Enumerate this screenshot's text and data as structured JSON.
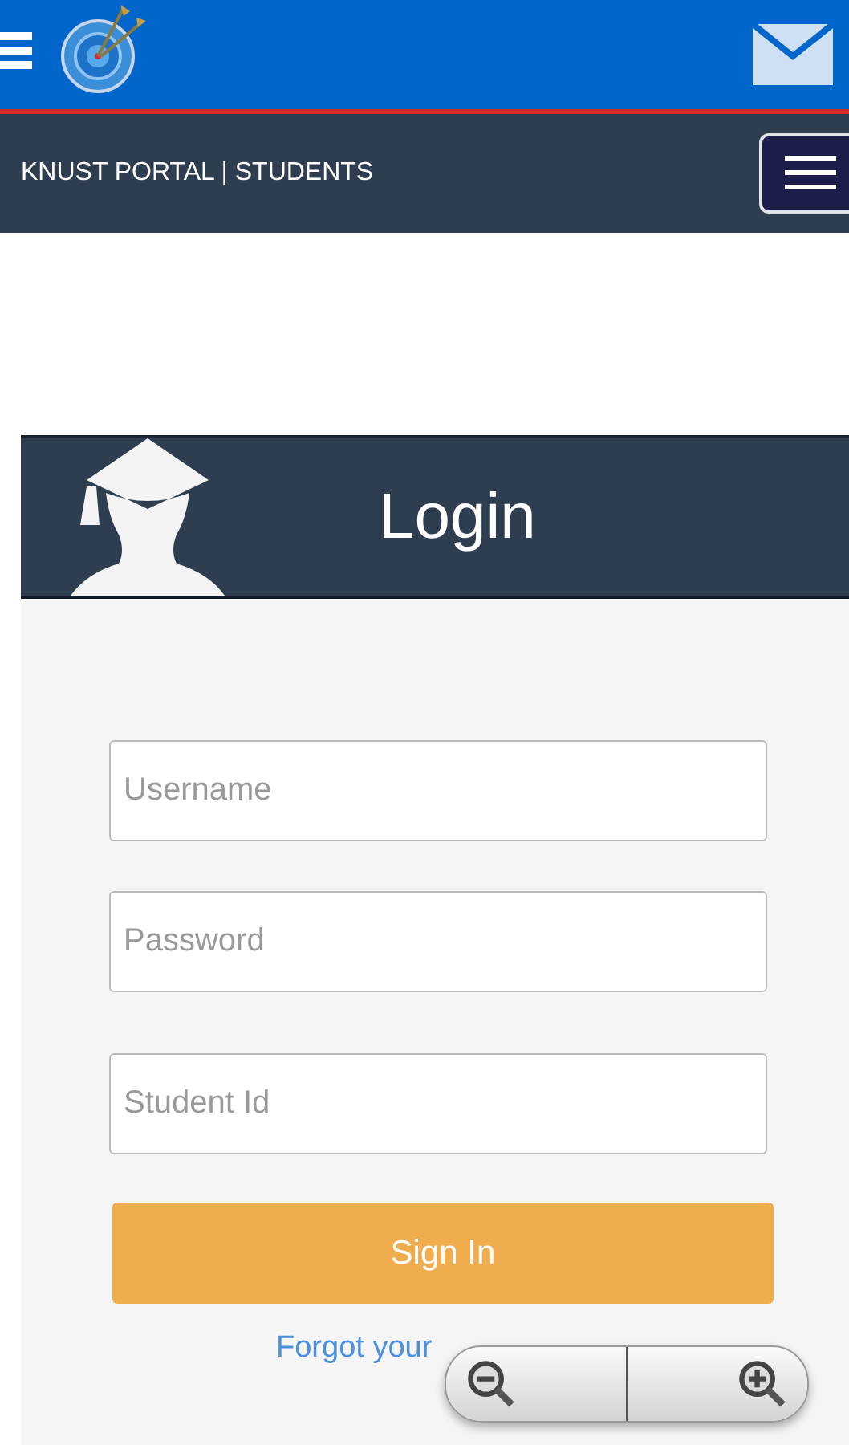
{
  "header": {
    "brand": "KNUST PORTAL | STUDENTS"
  },
  "login": {
    "title": "Login",
    "fields": [
      {
        "placeholder": "Username"
      },
      {
        "placeholder": "Password"
      },
      {
        "placeholder": "Student Id"
      }
    ],
    "submit": "Sign In",
    "forgot_link": "Forgot your"
  }
}
